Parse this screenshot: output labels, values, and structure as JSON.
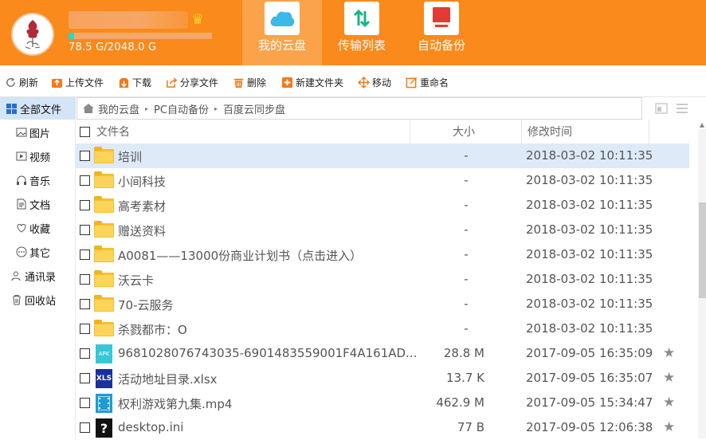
{
  "header": {
    "quota_text": "78.5 G/2048.0 G",
    "quota_fraction": 0.038,
    "tabs": [
      {
        "label": "我的云盘",
        "icon": "cloud-icon",
        "active": true
      },
      {
        "label": "传输列表",
        "icon": "transfer-icon",
        "active": false
      },
      {
        "label": "自动备份",
        "icon": "backup-disk-icon",
        "active": false
      }
    ]
  },
  "toolbar": {
    "refresh": "刷新",
    "upload": "上传文件",
    "download": "下载",
    "share": "分享文件",
    "delete": "删除",
    "new_folder": "新建文件夹",
    "move": "移动",
    "rename": "重命名"
  },
  "sidebar": {
    "all_files": "全部文件",
    "items": [
      {
        "label": "图片",
        "icon": "image-icon"
      },
      {
        "label": "视频",
        "icon": "video-icon"
      },
      {
        "label": "音乐",
        "icon": "headphones-icon"
      },
      {
        "label": "文档",
        "icon": "document-icon"
      },
      {
        "label": "收藏",
        "icon": "heart-icon"
      },
      {
        "label": "其它",
        "icon": "more-icon"
      },
      {
        "label": "通讯录",
        "icon": "contacts-icon"
      },
      {
        "label": "回收站",
        "icon": "trash-icon"
      }
    ]
  },
  "breadcrumb": {
    "items": [
      "我的云盘",
      "PC自动备份",
      "百度云同步盘"
    ]
  },
  "table": {
    "columns": {
      "name": "文件名",
      "size": "大小",
      "modified": "修改时间"
    },
    "rows": [
      {
        "type": "folder",
        "name": "培训",
        "size": "-",
        "modified": "2018-03-02 10:11:35",
        "selected": true
      },
      {
        "type": "folder",
        "name": "小间科技",
        "size": "-",
        "modified": "2018-03-02 10:11:35"
      },
      {
        "type": "folder",
        "name": "高考素材",
        "size": "-",
        "modified": "2018-03-02 10:11:35"
      },
      {
        "type": "folder",
        "name": "赠送资料",
        "size": "-",
        "modified": "2018-03-02 10:11:35"
      },
      {
        "type": "folder",
        "name": "A0081——13000份商业计划书（点击进入）",
        "size": "-",
        "modified": "2018-03-02 10:11:35"
      },
      {
        "type": "folder",
        "name": "沃云卡",
        "size": "-",
        "modified": "2018-03-02 10:11:35"
      },
      {
        "type": "folder",
        "name": "70-云服务",
        "size": "-",
        "modified": "2018-03-02 10:11:35"
      },
      {
        "type": "folder",
        "name": "杀戮都市：O",
        "size": "-",
        "modified": "2018-03-02 10:11:35"
      },
      {
        "type": "apk",
        "icon_text": "APK",
        "name": "9681028076743035-6901483559001F4A161AD...",
        "size": "28.8 M",
        "modified": "2017-09-05 16:35:09",
        "star": true
      },
      {
        "type": "xls",
        "icon_text": "XLS",
        "name": "活动地址目录.xlsx",
        "size": "13.7 K",
        "modified": "2017-09-05 16:35:07",
        "star": true
      },
      {
        "type": "mp4",
        "icon_text": "",
        "name": "权利游戏第九集.mp4",
        "size": "462.9 M",
        "modified": "2017-09-05 15:34:47",
        "star": true
      },
      {
        "type": "ini",
        "icon_text": "?",
        "name": "desktop.ini",
        "size": "77 B",
        "modified": "2017-09-05 12:06:38",
        "star": true
      }
    ]
  }
}
